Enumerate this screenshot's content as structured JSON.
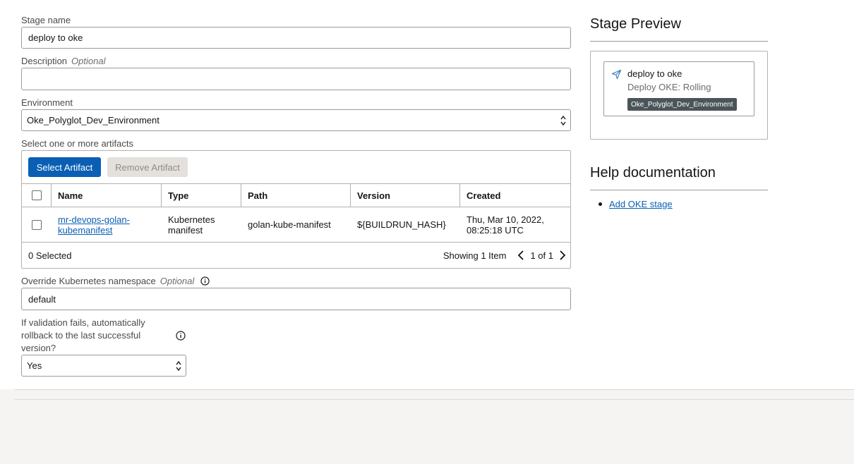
{
  "form": {
    "stage_name_label": "Stage name",
    "stage_name_value": "deploy to oke",
    "description_label": "Description",
    "description_optional": "Optional",
    "description_value": "",
    "environment_label": "Environment",
    "environment_value": "Oke_Polyglot_Dev_Environment",
    "artifacts_label": "Select one or more artifacts",
    "select_artifact_button": "Select Artifact",
    "remove_artifact_button": "Remove Artifact",
    "table": {
      "headers": [
        "Name",
        "Type",
        "Path",
        "Version",
        "Created"
      ],
      "rows": [
        {
          "name_line1": "mr-devops-golan-",
          "name_line2": "kubemanifest",
          "type_line1": "Kubernetes",
          "type_line2": "manifest",
          "path": "golan-kube-manifest",
          "version": "${BUILDRUN_HASH}",
          "created_line1": "Thu, Mar 10, 2022,",
          "created_line2": "08:25:18 UTC"
        }
      ],
      "selected_text": "0 Selected",
      "showing_text": "Showing 1 Item",
      "page_text": "1 of 1"
    },
    "namespace_label": "Override Kubernetes namespace",
    "namespace_optional": "Optional",
    "namespace_value": "default",
    "rollback_label_line1": "If validation fails, automatically",
    "rollback_label_line2": "rollback to the last successful",
    "rollback_label_line3": "version?",
    "rollback_value": "Yes"
  },
  "preview": {
    "heading": "Stage Preview",
    "card_title": "deploy to oke",
    "card_subtitle": "Deploy OKE: Rolling",
    "card_tag": "Oke_Polyglot_Dev_Environment"
  },
  "help": {
    "heading": "Help documentation",
    "links": [
      "Add OKE stage"
    ]
  },
  "colors": {
    "primary_button": "#0a5fb4",
    "link": "#0a5fb4",
    "tag_bg": "#4b5559"
  }
}
